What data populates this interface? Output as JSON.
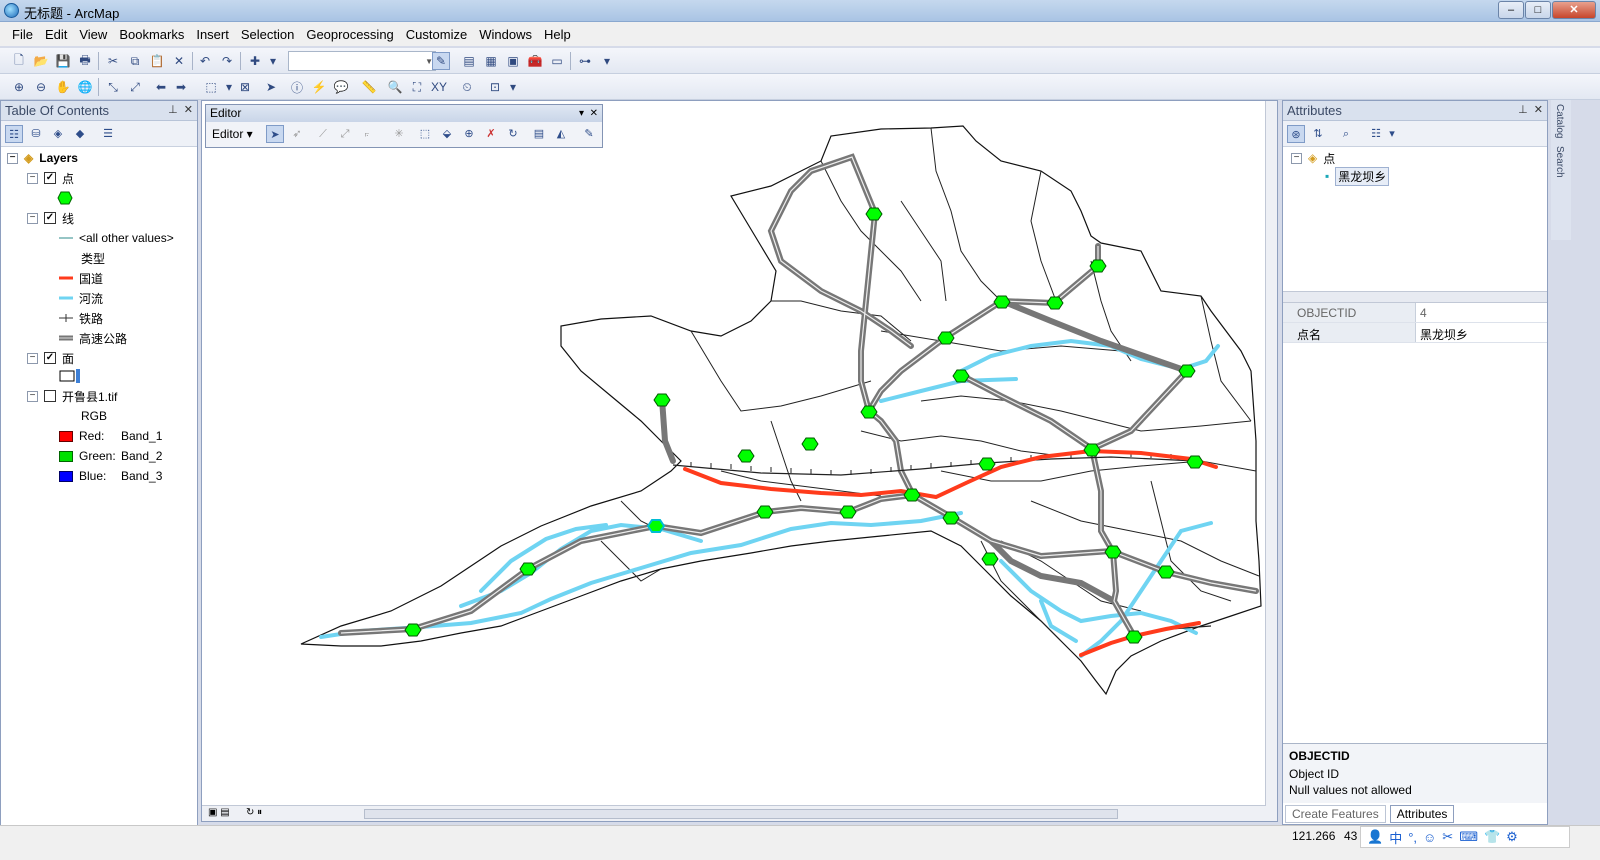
{
  "window": {
    "title": "无标题 - ArcMap"
  },
  "menu": [
    "File",
    "Edit",
    "View",
    "Bookmarks",
    "Insert",
    "Selection",
    "Geoprocessing",
    "Customize",
    "Windows",
    "Help"
  ],
  "toc": {
    "title": "Table Of Contents",
    "root": "Layers",
    "layers": {
      "points": "点",
      "lines": "线",
      "all_other": "<all other values>",
      "type_field": "类型",
      "guodao": "国道",
      "river": "河流",
      "railway": "铁路",
      "expressway": "高速公路",
      "polygons": "面",
      "raster": "开鲁县1.tif",
      "rgb": "RGB",
      "red": "Red:",
      "red_band": "Band_1",
      "green": "Green:",
      "green_band": "Band_2",
      "blue": "Blue:",
      "blue_band": "Band_3"
    }
  },
  "editor": {
    "title": "Editor",
    "menu": "Editor ▾"
  },
  "attributes": {
    "title": "Attributes",
    "tree_layer": "点",
    "tree_feature": "黑龙坝乡",
    "rows": [
      {
        "key": "OBJECTID",
        "value": "4"
      },
      {
        "key": "点名",
        "value": "黑龙坝乡"
      }
    ],
    "field_name": "OBJECTID",
    "field_alias": "Object ID",
    "field_note": "Null values not allowed",
    "tab_create": "Create Features",
    "tab_attributes": "Attributes"
  },
  "sidetabs": [
    "Catalog",
    "Search"
  ],
  "status": {
    "coords": "121.266",
    "coords_cut": "43"
  },
  "colors": {
    "guodao": "#ff3b1c",
    "river": "#6fd4f2",
    "point": "#00ff00"
  }
}
